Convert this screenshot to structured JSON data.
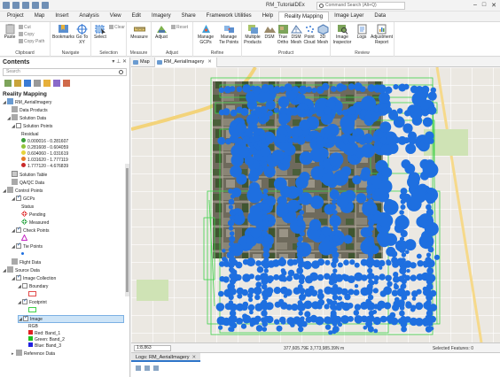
{
  "titlebar": {
    "title": "RM_TutorialDEx",
    "search_placeholder": "Command Search (Alt+Q)",
    "window_controls": [
      "minimize",
      "maximize",
      "close"
    ]
  },
  "ribbon_tabs": [
    "Project",
    "Map",
    "Insert",
    "Analysis",
    "View",
    "Edit",
    "Imagery",
    "Share",
    "Framework Utilities",
    "Help",
    "Reality Mapping",
    "Image Layer",
    "Data"
  ],
  "active_tab": "Reality Mapping",
  "ribbon": {
    "clipboard": {
      "name": "Clipboard",
      "paste": "Paste",
      "cut": "Cut",
      "copy": "Copy",
      "copy_path": "Copy Path"
    },
    "navigate": {
      "name": "Navigate",
      "bookmarks": "Bookmarks",
      "goto": "Go To XY"
    },
    "selection": {
      "name": "Selection",
      "select": "Select",
      "clear": "Clear"
    },
    "measure": {
      "name": "Measure",
      "measure": "Measure"
    },
    "adjust": {
      "name": "Adjust",
      "adjust": "Adjust",
      "reset": "Reset"
    },
    "refine": {
      "name": "Refine",
      "manage_gcps": "Manage GCPs",
      "manage_tie_points": "Manage Tie Points"
    },
    "product": {
      "name": "Product",
      "multiple_products": "Multiple Products",
      "dsm": "DSM",
      "true_ortho": "True Ortho",
      "dsm_mesh": "DSM Mesh",
      "point_cloud": "Point Cloud",
      "mesh_3d": "3D Mesh"
    },
    "review": {
      "name": "Review",
      "image_inspector": "Image Inspector",
      "logs": "Logs",
      "adjustment_report": "Adjustment Report"
    }
  },
  "contents": {
    "title": "Contents",
    "search_placeholder": "Search",
    "header": "Reality Mapping",
    "items": {
      "root": "RM_AerialImagery",
      "data_products": "Data Products",
      "solution_data": "Solution Data",
      "solution_points": "Solution Points",
      "residual": "Residual",
      "residual_classes": [
        {
          "label": "0.000016 - 0.281607",
          "color": "#3a9e3a"
        },
        {
          "label": "0.281608 - 0.604059",
          "color": "#8fc43b"
        },
        {
          "label": "0.604060 - 1.031619",
          "color": "#e6d33a"
        },
        {
          "label": "1.031620 - 1.777119",
          "color": "#e57b2a"
        },
        {
          "label": "1.777120 - 4.676839",
          "color": "#c92a2a"
        }
      ],
      "solution_table": "Solution Table",
      "qaqc_data": "QA/QC Data",
      "control_points": "Control Points",
      "gcps": "GCPs",
      "status": "Status",
      "pending": "Pending",
      "measured": "Measured",
      "check_points": "Check Points",
      "tie_points": "Tie Points",
      "flight_data": "Flight Data",
      "source_data": "Source Data",
      "image_collection": "Image Collection",
      "boundary": "Boundary",
      "footprint": "Footprint",
      "image": "Image",
      "rgb": "RGB",
      "red_band": "Red:  Band_1",
      "green_band": "Green: Band_2",
      "blue_band": "Blue:  Band_3",
      "reference_data": "Reference Data"
    }
  },
  "map_tabs": [
    "Map",
    "RM_AerialImagery"
  ],
  "statusbar": {
    "scale": "1:8,863",
    "coords": "377,605.79E 3,773,985.39N m",
    "selected": "Selected Features: 0"
  },
  "logs_tab": "Logs: RM_AerialImagery",
  "colors": {
    "accent": "#2e75c9",
    "tie_points": "#1e6fe0",
    "footprint": "#3fd14a"
  }
}
